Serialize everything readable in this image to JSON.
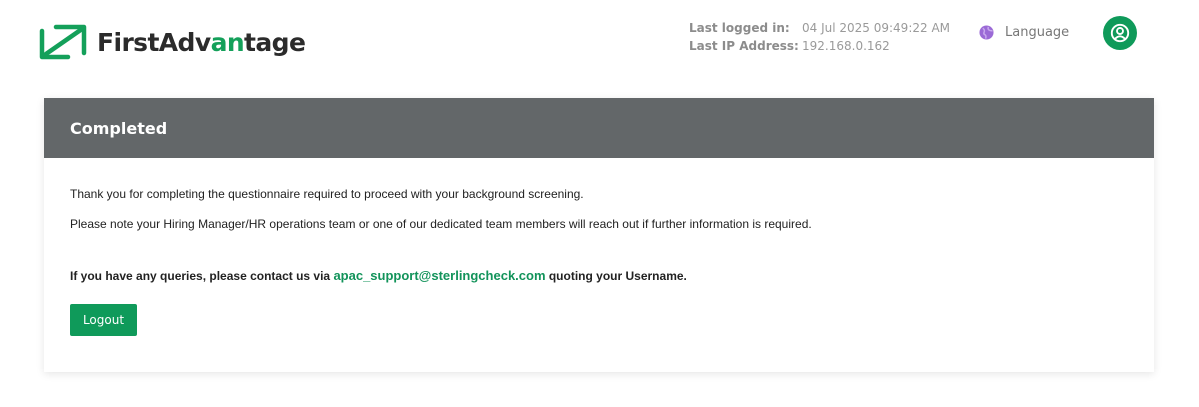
{
  "header": {
    "logo": {
      "text_main": "FirstAdv",
      "text_accent": "an",
      "text_end": "tage",
      "brand_color": "#14a05a"
    },
    "login_info": {
      "last_logged_in_label": "Last logged in:",
      "last_logged_in_value": "04 Jul 2025 09:49:22 AM",
      "last_ip_label": "Last IP Address:",
      "last_ip_value": "192.168.0.162"
    },
    "language_label": "Language",
    "language_icon": "globe-icon",
    "user_icon": "user-circle-icon"
  },
  "card": {
    "title": "Completed",
    "header_color": "#636769",
    "line1": "Thank you for completing the questionnaire required to proceed with your background screening.",
    "line2": "Please note your Hiring Manager/HR operations team or one of our dedicated team members will reach out if further information is required.",
    "query_prefix": "If you have any queries, please contact us via ",
    "email": "apac_support@sterlingcheck.com",
    "query_suffix": " quoting your Username.",
    "logout_label": "Logout",
    "accent_color": "#0f9a5a"
  }
}
